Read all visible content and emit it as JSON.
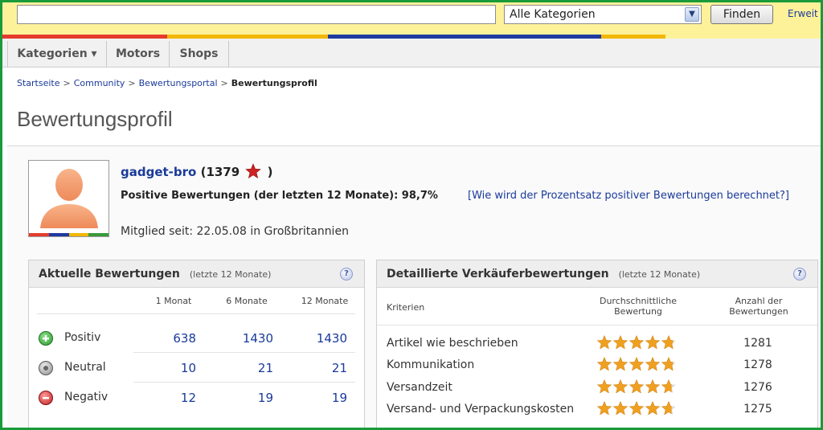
{
  "search": {
    "query": "",
    "category_selected": "Alle Kategorien",
    "find_label": "Finden",
    "advanced_label": "Erweit"
  },
  "nav": {
    "tabs": [
      {
        "label": "Kategorien ▾"
      },
      {
        "label": "Motors"
      },
      {
        "label": "Shops"
      }
    ]
  },
  "breadcrumb": {
    "items": [
      "Startseite",
      "Community",
      "Bewertungsportal"
    ],
    "current": "Bewertungsprofil",
    "separator": ">"
  },
  "page": {
    "title": "Bewertungsprofil"
  },
  "profile": {
    "username": "gadget-bro",
    "score_open": "(",
    "score": "1379",
    "score_close": ")",
    "star_color": "#cc2222",
    "positive_text": "Positive Bewertungen (der letzten 12 Monate): 98,7%",
    "percent_link": "[Wie wird der Prozentsatz positiver Bewertungen berechnet?]",
    "member_since": "Mitglied seit: 22.05.08 in Großbritannien"
  },
  "current_ratings": {
    "title": "Aktuelle Bewertungen",
    "subtitle": "(letzte 12 Monate)",
    "help_icon": "?",
    "columns": [
      "1 Monat",
      "6 Monate",
      "12 Monate"
    ],
    "rows": [
      {
        "label": "Positiv",
        "icon": "plus-circle-icon",
        "values": [
          "638",
          "1430",
          "1430"
        ]
      },
      {
        "label": "Neutral",
        "icon": "neutral-circle-icon",
        "values": [
          "10",
          "21",
          "21"
        ]
      },
      {
        "label": "Negativ",
        "icon": "minus-circle-icon",
        "values": [
          "12",
          "19",
          "19"
        ]
      }
    ]
  },
  "seller_ratings": {
    "title": "Detaillierte Verkäuferbewertungen",
    "subtitle": "(letzte 12 Monate)",
    "help_icon": "?",
    "col_criteria": "Kriterien",
    "col_avg": "Durchschnittliche Bewertung",
    "col_count": "Anzahl der Bewertungen",
    "rows": [
      {
        "label": "Artikel wie beschrieben",
        "stars": 4.8,
        "count": "1281"
      },
      {
        "label": "Kommunikation",
        "stars": 4.8,
        "count": "1278"
      },
      {
        "label": "Versandzeit",
        "stars": 4.7,
        "count": "1276"
      },
      {
        "label": "Versand- und Verpackungskosten",
        "stars": 4.7,
        "count": "1275"
      }
    ]
  },
  "colors": {
    "top_bar": "#fdf29a",
    "strip": [
      "#e53b2c",
      "#1f3aa0",
      "#f2b705",
      "#3a9a3a"
    ],
    "link": "#1a3a9a",
    "star": "#f0a020"
  }
}
